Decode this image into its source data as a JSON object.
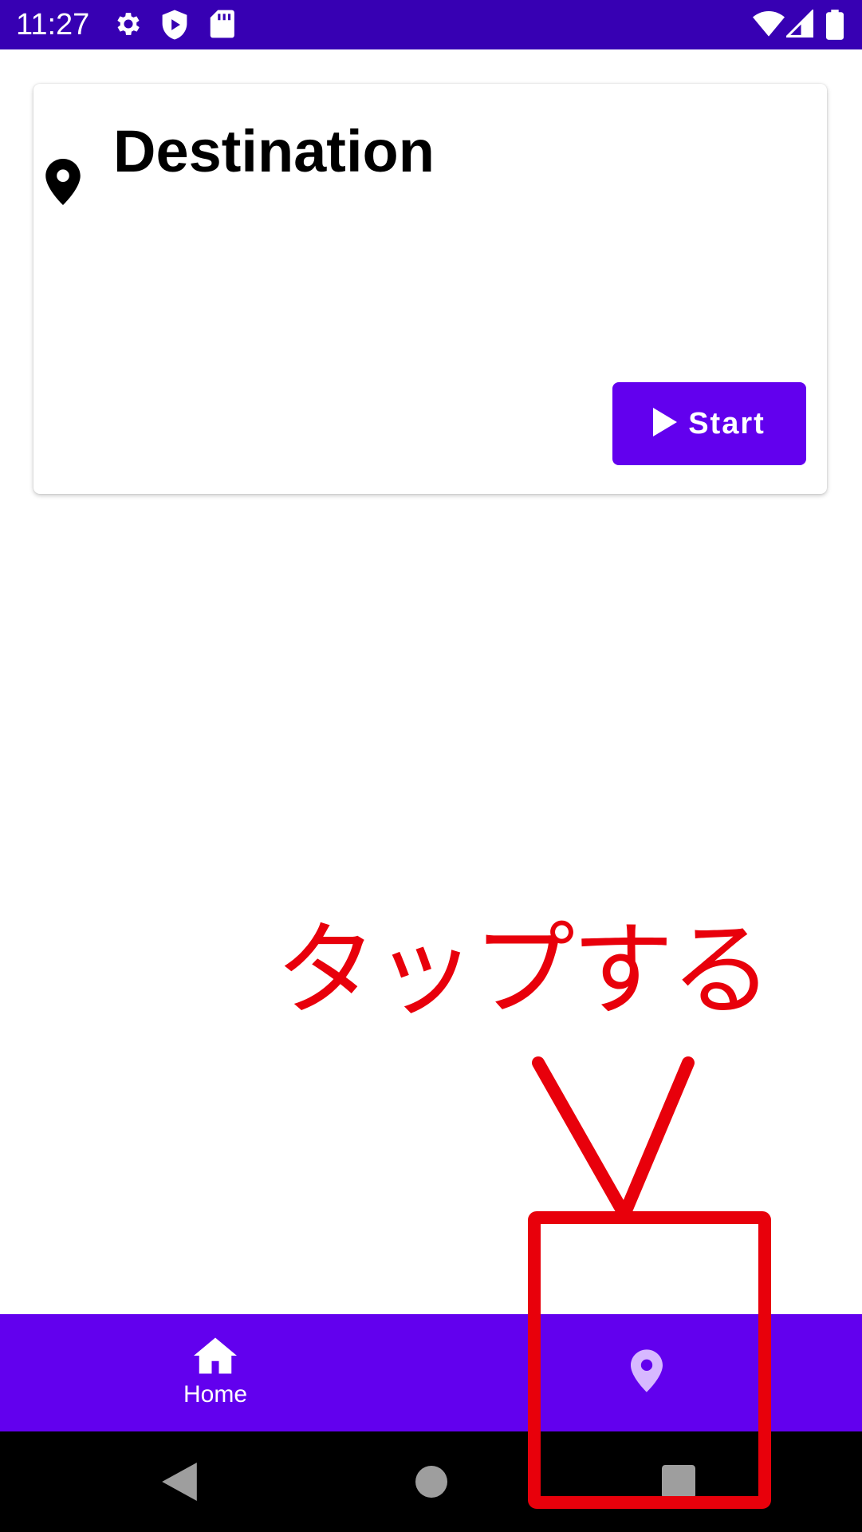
{
  "status_bar": {
    "time": "11:27",
    "left_icons": [
      "gear-icon",
      "shield-play-icon",
      "sd-card-icon"
    ],
    "right_icons": [
      "wifi-icon",
      "signal-icon",
      "battery-icon"
    ],
    "background": "#3700b3"
  },
  "card": {
    "title": "Destination",
    "icon": "location-pin-icon",
    "start_button": {
      "label": "Start",
      "icon": "play-icon"
    }
  },
  "annotation": {
    "text": "タップする",
    "color": "#e8000b"
  },
  "bottom_nav": {
    "background": "#6200ee",
    "items": [
      {
        "label": "Home",
        "icon": "home-icon",
        "selected": false
      },
      {
        "label": "",
        "icon": "location-pin-icon",
        "selected": true
      }
    ]
  },
  "system_nav": {
    "buttons": [
      "back-icon",
      "home-circle-icon",
      "recents-icon"
    ]
  }
}
